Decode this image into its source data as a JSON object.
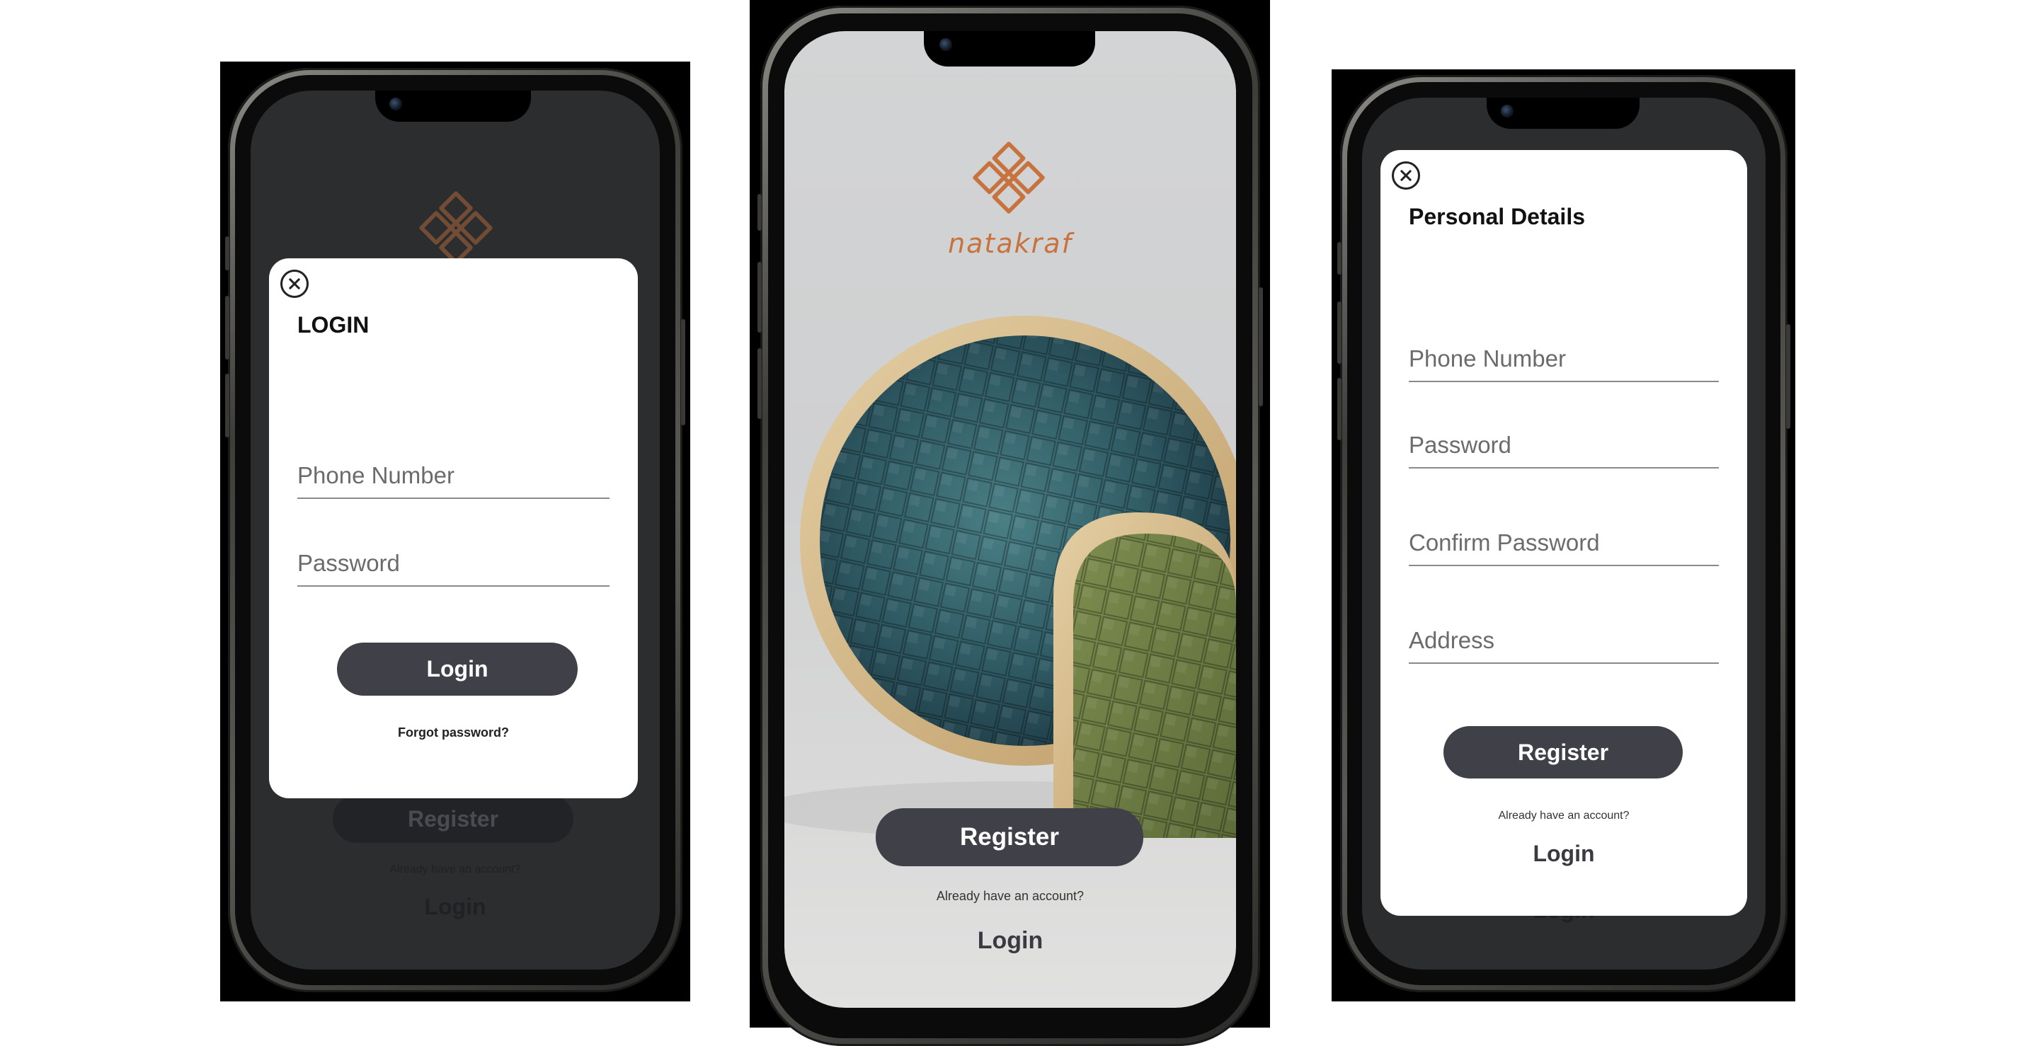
{
  "brand": {
    "logo": "natakraf-knot-logo",
    "name": "natakraf",
    "accent": "#c8723e"
  },
  "colors": {
    "button_bg": "#3f4048",
    "overlay_bg": "#2c2d2e",
    "card_bg": "#ffffff"
  },
  "welcome": {
    "register_label": "Register",
    "account_prompt": "Already have an account?",
    "login_label": "Login"
  },
  "login_modal": {
    "close_icon": "close-circle-icon",
    "title": "LOGIN",
    "phone_placeholder": "Phone Number",
    "password_placeholder": "Password",
    "submit_label": "Login",
    "forgot_label": "Forgot password?"
  },
  "register_modal": {
    "close_icon": "close-circle-icon",
    "title": "Personal Details",
    "phone_placeholder": "Phone Number",
    "password_placeholder": "Password",
    "confirm_placeholder": "Confirm Password",
    "address_placeholder": "Address",
    "submit_label": "Register",
    "account_prompt": "Already have an account?",
    "login_label": "Login"
  }
}
